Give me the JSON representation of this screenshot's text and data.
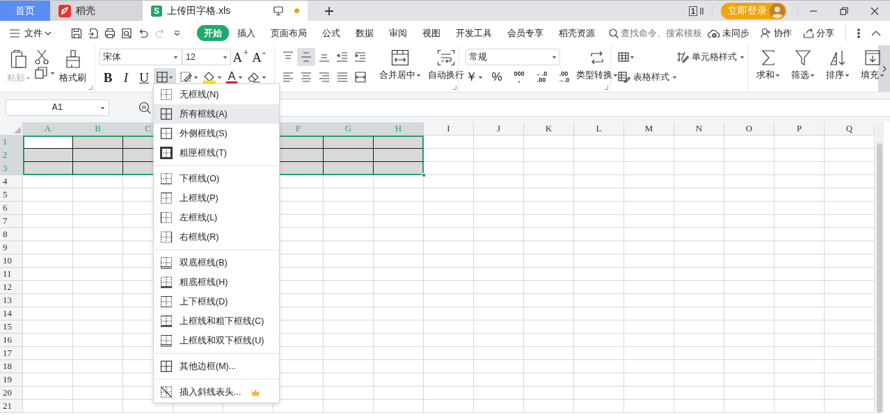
{
  "tabs": [
    {
      "label": "首页",
      "kind": "home",
      "selected": false,
      "unsaved": false
    },
    {
      "label": "稻壳",
      "kind": "docer",
      "selected": false,
      "unsaved": false
    },
    {
      "label": "上传田字格.xls",
      "kind": "sheet",
      "badge": "S",
      "selected": true,
      "unsaved": true
    }
  ],
  "title_bar": {
    "window_count": "1",
    "login": "立即登录"
  },
  "menu_bar": {
    "file": "文件",
    "tabs": [
      {
        "label": "开始",
        "selected": true
      },
      {
        "label": "插入",
        "selected": false
      },
      {
        "label": "页面布局",
        "selected": false
      },
      {
        "label": "公式",
        "selected": false
      },
      {
        "label": "数据",
        "selected": false
      },
      {
        "label": "审阅",
        "selected": false
      },
      {
        "label": "视图",
        "selected": false
      },
      {
        "label": "开发工具",
        "selected": false
      },
      {
        "label": "会员专享",
        "selected": false
      },
      {
        "label": "稻壳资源",
        "selected": false
      }
    ],
    "search": {
      "placeholder": "查找命令、搜索模板"
    },
    "actions": [
      {
        "kind": "sync",
        "label": "未同步"
      },
      {
        "kind": "collab",
        "label": "协作"
      },
      {
        "kind": "share",
        "label": "分享"
      }
    ]
  },
  "ribbon": {
    "paste": {
      "label": "粘贴",
      "disabled": true
    },
    "format_painter": "格式刷",
    "font": {
      "name": "宋体",
      "size": "12",
      "grow": "A$^{+}$",
      "shrink": "A$^{-}$",
      "bold": "B",
      "italic": "I",
      "underline": "U",
      "font_color": "A",
      "borders_expanded": true
    },
    "alignment": [
      {
        "kind": "top",
        "selected": false
      },
      {
        "kind": "middle",
        "selected": true
      },
      {
        "kind": "bottom",
        "selected": false
      },
      {
        "kind": "outdent",
        "selected": false
      },
      {
        "kind": "indent",
        "selected": false
      },
      {
        "kind": "left",
        "selected": false
      },
      {
        "kind": "center",
        "selected": false
      },
      {
        "kind": "right",
        "selected": false
      },
      {
        "kind": "justify",
        "selected": false
      },
      {
        "kind": "distributed",
        "selected": false
      }
    ],
    "merge": "合并居中",
    "wrap": "自动换行",
    "number": {
      "format": "常规",
      "convert": "类型转换",
      "buttons": [
        {
          "kind": "currency",
          "lines": [
            "￥"
          ]
        },
        {
          "kind": "percent",
          "lines": [
            "%"
          ]
        },
        {
          "kind": "thousands",
          "lines": [
            "000",
            ","
          ]
        },
        {
          "kind": "add_decimal",
          "lines": [
            "←.0",
            ".00"
          ]
        },
        {
          "kind": "remove_decimal",
          "lines": [
            ".00",
            "→.0"
          ]
        }
      ]
    },
    "styles": {
      "cell_style": "单元格样式",
      "table_style": "表格样式"
    },
    "tools": [
      {
        "kind": "sum",
        "label": "求和"
      },
      {
        "kind": "filter",
        "label": "筛选"
      },
      {
        "kind": "sort",
        "label": "排序"
      },
      {
        "kind": "fill",
        "label": "填充"
      }
    ]
  },
  "name_box": "A1",
  "grid": {
    "columns": [
      {
        "label": "A",
        "selected": true
      },
      {
        "label": "B",
        "selected": true
      },
      {
        "label": "C",
        "selected": true
      },
      {},
      {},
      {
        "label": "F",
        "selected": true
      },
      {
        "label": "G",
        "selected": true
      },
      {
        "label": "H",
        "selected": true
      },
      {
        "label": "I",
        "selected": false
      },
      {
        "label": "J",
        "selected": false
      },
      {
        "label": "K",
        "selected": false
      },
      {
        "label": "L",
        "selected": false
      },
      {
        "label": "M",
        "selected": false
      },
      {
        "label": "N",
        "selected": false
      },
      {
        "label": "O",
        "selected": false
      },
      {
        "label": "P",
        "selected": false
      },
      {
        "label": "Q",
        "selected": false
      }
    ],
    "rows": [
      {
        "label": "1",
        "selected": true
      },
      {
        "label": "2",
        "selected": true
      },
      {
        "label": "3",
        "selected": true
      },
      {
        "label": "4",
        "selected": false
      },
      {
        "label": "5",
        "selected": false
      },
      {
        "label": "6",
        "selected": false
      },
      {
        "label": "7",
        "selected": false
      },
      {
        "label": "8",
        "selected": false
      },
      {
        "label": "9",
        "selected": false
      },
      {
        "label": "10",
        "selected": false
      },
      {
        "label": "11",
        "selected": false
      },
      {
        "label": "12",
        "selected": false
      },
      {
        "label": "13",
        "selected": false
      },
      {
        "label": "14",
        "selected": false
      },
      {
        "label": "15",
        "selected": false
      },
      {
        "label": "16",
        "selected": false
      },
      {
        "label": "17",
        "selected": false
      },
      {
        "label": "18",
        "selected": false
      },
      {
        "label": "19",
        "selected": false
      },
      {
        "label": "20",
        "selected": false
      },
      {
        "label": "21",
        "selected": false
      }
    ]
  },
  "border_menu": {
    "groups": [
      [
        {
          "kind": "none",
          "label": "无框线(N)",
          "selected": false,
          "premium": false
        },
        {
          "kind": "all",
          "label": "所有框线(A)",
          "selected": true,
          "premium": false
        },
        {
          "kind": "outside",
          "label": "外侧框线(S)",
          "selected": false,
          "premium": false
        },
        {
          "kind": "thickbox",
          "label": "粗匣框线(T)",
          "selected": false,
          "premium": false
        }
      ],
      [
        {
          "kind": "bottom",
          "label": "下框线(O)",
          "selected": false,
          "premium": false
        },
        {
          "kind": "top",
          "label": "上框线(P)",
          "selected": false,
          "premium": false
        },
        {
          "kind": "left",
          "label": "左框线(L)",
          "selected": false,
          "premium": false
        },
        {
          "kind": "right",
          "label": "右框线(R)",
          "selected": false,
          "premium": false
        }
      ],
      [
        {
          "kind": "doublebottom",
          "label": "双底框线(B)",
          "selected": false,
          "premium": false
        },
        {
          "kind": "thickbottom",
          "label": "粗底框线(H)",
          "selected": false,
          "premium": false
        },
        {
          "kind": "topbottom",
          "label": "上下框线(D)",
          "selected": false,
          "premium": false
        },
        {
          "kind": "topthickbottom",
          "label": "上框线和粗下框线(C)",
          "selected": false,
          "premium": false
        },
        {
          "kind": "topdoublebottom",
          "label": "上框线和双下框线(U)",
          "selected": false,
          "premium": false
        }
      ],
      [
        {
          "kind": "more",
          "label": "其他边框(M)...",
          "selected": false,
          "premium": false
        }
      ],
      [
        {
          "kind": "diagonal",
          "label": "插入斜线表头...",
          "selected": false,
          "premium": true
        }
      ]
    ]
  }
}
